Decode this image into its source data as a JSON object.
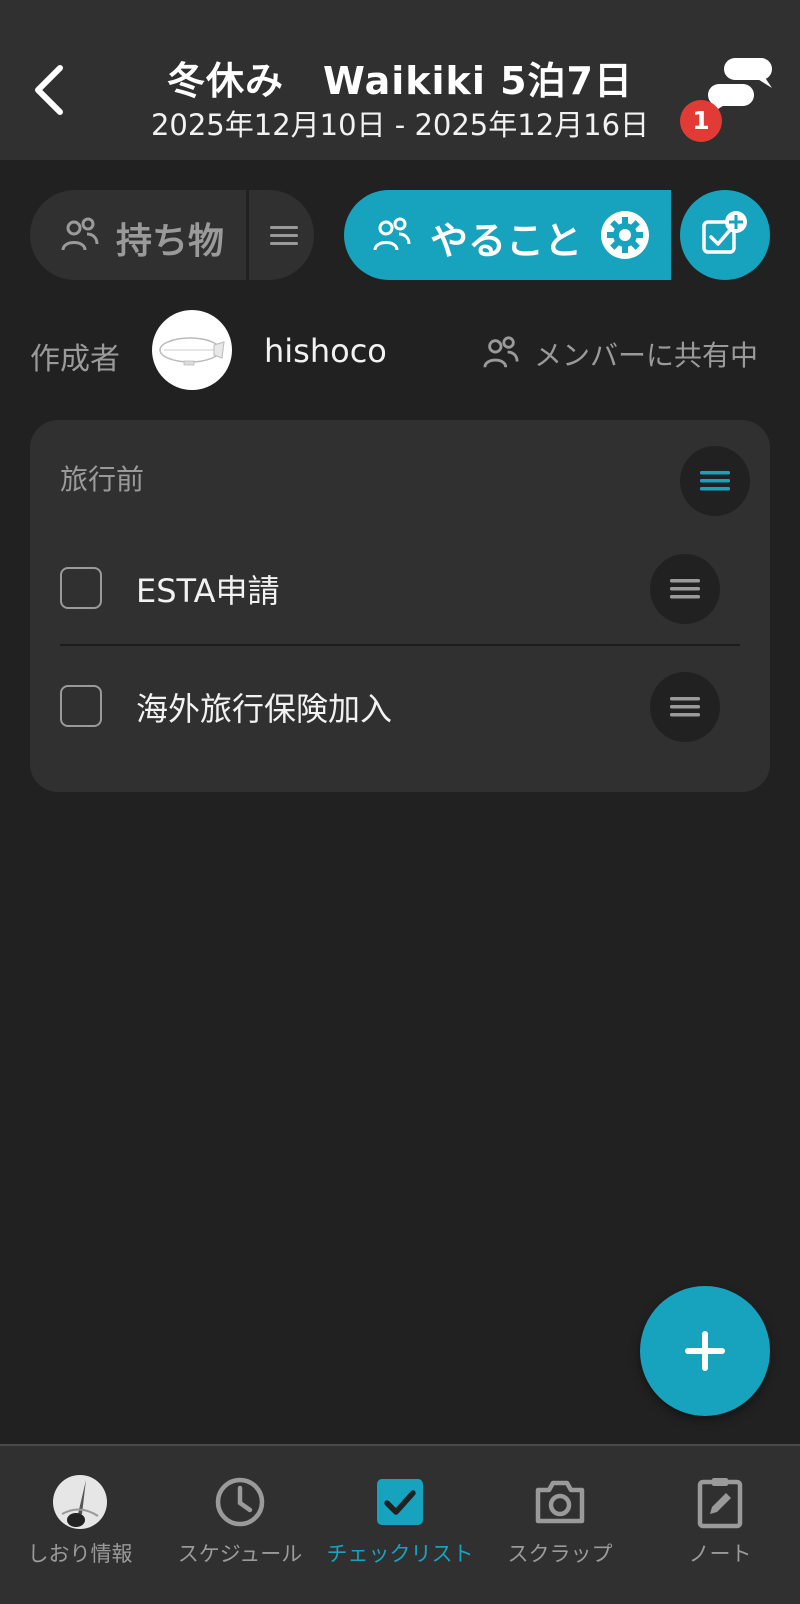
{
  "header": {
    "title": "冬休み　Waikiki 5泊7日",
    "dates": "2025年12月10日 - 2025年12月16日",
    "chat_badge": "1"
  },
  "tabs": {
    "belongings_label": "持ち物",
    "todo_label": "やること"
  },
  "author": {
    "label": "作成者",
    "name": "hishoco",
    "share_status": "メンバーに共有中"
  },
  "checklist": {
    "group_title": "旅行前",
    "items": [
      {
        "label": "ESTA申請",
        "checked": false
      },
      {
        "label": "海外旅行保険加入",
        "checked": false
      }
    ]
  },
  "bottom_nav": {
    "items": [
      {
        "label": "しおり情報",
        "icon": "trip-photo-icon"
      },
      {
        "label": "スケジュール",
        "icon": "clock-icon"
      },
      {
        "label": "チェックリスト",
        "icon": "checkbox-icon",
        "active": true
      },
      {
        "label": "スクラップ",
        "icon": "camera-icon"
      },
      {
        "label": "ノート",
        "icon": "note-edit-icon"
      }
    ]
  },
  "colors": {
    "accent": "#17a3bd",
    "background": "#212121",
    "surface": "#303030",
    "badge": "#e23b35"
  }
}
